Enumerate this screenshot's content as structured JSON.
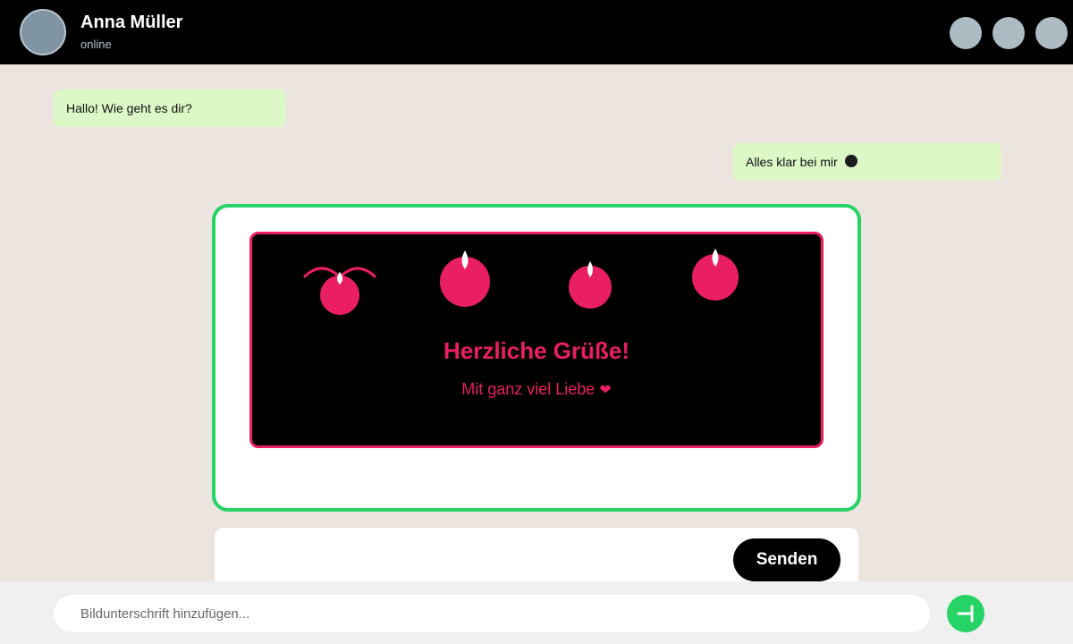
{
  "contact": {
    "name": "Anna Müller",
    "status": "online"
  },
  "header_actions": [
    "video-call-icon",
    "phone-icon",
    "menu-icon"
  ],
  "messages": [
    {
      "direction": "incoming",
      "text": "Hallo! Wie geht es dir?"
    },
    {
      "direction": "outgoing",
      "text": "Alles klar bei mir",
      "emoji_icon": "smiley-emoji-icon"
    }
  ],
  "image_preview": {
    "title": "Herzliche Grüße!",
    "subtitle": "Mit ganz viel Liebe",
    "subtitle_icon": "heart-icon",
    "decorations": [
      "cherry-icon",
      "cherry-icon",
      "cherry-icon",
      "cherry-icon"
    ]
  },
  "send_button": {
    "label": "Senden"
  },
  "composer": {
    "placeholder": "Bildunterschrift hinzufügen...",
    "value": ""
  },
  "colors": {
    "accent": "#25d366",
    "card_accent": "#e91e63",
    "bubble": "#dcf8c6",
    "header_bg": "#000000",
    "chat_bg": "#ece4df"
  }
}
